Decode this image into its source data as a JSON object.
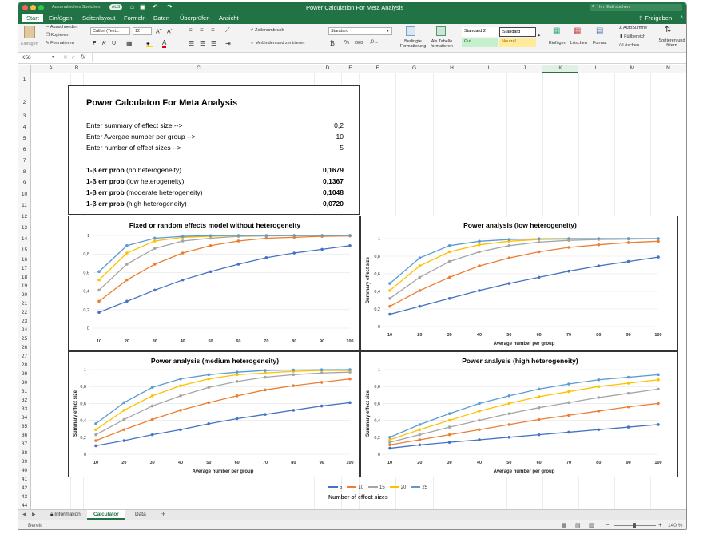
{
  "app": {
    "title": "Power Calculation For Meta Analysis",
    "autosave_label": "Automatisches Speichern",
    "autosave_state": "AUS",
    "search_placeholder": "Im Blatt suchen",
    "share_label": "Freigeben"
  },
  "ribbon_tabs": [
    "Start",
    "Einfügen",
    "Seitenlayout",
    "Formeln",
    "Daten",
    "Überprüfen",
    "Ansicht"
  ],
  "ribbon": {
    "paste": "Einfügen",
    "cut": "Ausschneiden",
    "copy": "Kopieren",
    "format_painter": "Formatieren",
    "font_name": "Calibri (Text...",
    "font_size": "12",
    "bold": "F",
    "italic": "K",
    "underline": "U",
    "wrap_text": "Zeilenumbruch",
    "merge_center": "Verbinden und zentrieren",
    "number_format": "Standard",
    "cond_format": "Bedingte Formatierung",
    "as_table": "Als Tabelle formatieren",
    "styles": [
      "Standard 2",
      "Standard",
      "Gut",
      "Neutral"
    ],
    "insert": "Einfügen",
    "delete": "Löschen",
    "format": "Format",
    "autosum": "AutoSumme",
    "fill": "Füllbereich",
    "clear": "Löschen",
    "sort_filter": "Sortieren und filtern"
  },
  "formula_bar": {
    "name_box": "K58",
    "fx": "fx",
    "value": ""
  },
  "columns": [
    "A",
    "B",
    "C",
    "D",
    "E",
    "F",
    "G",
    "H",
    "I",
    "J",
    "K",
    "L",
    "M",
    "N"
  ],
  "rows": [
    "1",
    "2",
    "3",
    "4",
    "5",
    "6",
    "7",
    "8",
    "9",
    "10",
    "11",
    "12",
    "13",
    "14",
    "15",
    "16",
    "17",
    "18",
    "19",
    "20",
    "21",
    "22",
    "23",
    "24",
    "25",
    "26",
    "27",
    "28",
    "29",
    "30",
    "31",
    "32",
    "33",
    "34",
    "35",
    "36",
    "37",
    "38",
    "39",
    "40",
    "41",
    "42",
    "43",
    "44",
    "45"
  ],
  "calculator": {
    "heading": "Power Calculaton For Meta Analysis",
    "inputs": [
      {
        "label": "Enter summary of effect size -->",
        "value": "0,2"
      },
      {
        "label": "Enter Avergae number per group -->",
        "value": "10"
      },
      {
        "label": "Enter number of effect sizes -->",
        "value": "5"
      }
    ],
    "outputs": [
      {
        "label_bold": "1-β err prob",
        "label_rest": " (no heterogeneity)",
        "value": "0,1679"
      },
      {
        "label_bold": "1-β err prob",
        "label_rest": " (low heterogeneity)",
        "value": "0,1367"
      },
      {
        "label_bold": "1-β err prob",
        "label_rest": " (moderate heterogeneity)",
        "value": "0,1048"
      },
      {
        "label_bold": "1-β err prob",
        "label_rest": " (high heterogeneity)",
        "value": "0,0720"
      }
    ]
  },
  "series_colors": {
    "5": "#4472c4",
    "10": "#ed7d31",
    "15": "#a5a5a5",
    "20": "#ffc000",
    "25": "#5b9bd5"
  },
  "legend": {
    "items": [
      "5",
      "10",
      "15",
      "20",
      "25"
    ],
    "title": "Number of effect sizes"
  },
  "chart_data": [
    {
      "type": "line",
      "title": "Fixed or random effects model without heterogeneity",
      "xlabel": "",
      "ylabel": "",
      "x": [
        10,
        20,
        30,
        40,
        50,
        60,
        70,
        80,
        90,
        100
      ],
      "ylim": [
        0,
        1
      ],
      "yticks": [
        "0",
        "0,2",
        "0,4",
        "0,6",
        "0,8",
        "1"
      ],
      "series": [
        {
          "name": "5",
          "values": [
            0.17,
            0.29,
            0.41,
            0.52,
            0.61,
            0.69,
            0.76,
            0.81,
            0.85,
            0.89
          ]
        },
        {
          "name": "10",
          "values": [
            0.29,
            0.52,
            0.69,
            0.81,
            0.89,
            0.94,
            0.97,
            0.98,
            0.99,
            0.995
          ]
        },
        {
          "name": "15",
          "values": [
            0.41,
            0.69,
            0.86,
            0.94,
            0.97,
            0.99,
            0.995,
            0.998,
            0.999,
            1.0
          ]
        },
        {
          "name": "20",
          "values": [
            0.52,
            0.81,
            0.94,
            0.98,
            0.99,
            0.998,
            1.0,
            1.0,
            1.0,
            1.0
          ]
        },
        {
          "name": "25",
          "values": [
            0.61,
            0.89,
            0.97,
            0.99,
            0.998,
            1.0,
            1.0,
            1.0,
            1.0,
            1.0
          ]
        }
      ]
    },
    {
      "type": "line",
      "title": "Power analysis (low heterogeneity)",
      "xlabel": "Average number per group",
      "ylabel": "Summary effect size",
      "x": [
        10,
        20,
        30,
        40,
        50,
        60,
        70,
        80,
        90,
        100
      ],
      "ylim": [
        0,
        1
      ],
      "yticks": [
        "0",
        "0,2",
        "0,4",
        "0,6",
        "0,8",
        "1"
      ],
      "series": [
        {
          "name": "5",
          "values": [
            0.14,
            0.23,
            0.32,
            0.41,
            0.49,
            0.56,
            0.63,
            0.69,
            0.74,
            0.79
          ]
        },
        {
          "name": "10",
          "values": [
            0.23,
            0.41,
            0.56,
            0.69,
            0.78,
            0.85,
            0.9,
            0.93,
            0.955,
            0.97
          ]
        },
        {
          "name": "15",
          "values": [
            0.32,
            0.56,
            0.74,
            0.85,
            0.92,
            0.96,
            0.98,
            0.99,
            0.995,
            0.998
          ]
        },
        {
          "name": "20",
          "values": [
            0.41,
            0.69,
            0.85,
            0.93,
            0.97,
            0.99,
            0.995,
            0.998,
            1.0,
            1.0
          ]
        },
        {
          "name": "25",
          "values": [
            0.49,
            0.78,
            0.92,
            0.97,
            0.99,
            0.998,
            1.0,
            1.0,
            1.0,
            1.0
          ]
        }
      ]
    },
    {
      "type": "line",
      "title": "Power analysis (medium heterogeneity)",
      "xlabel": "Average number per group",
      "ylabel": "Summary effect size",
      "x": [
        10,
        20,
        30,
        40,
        50,
        60,
        70,
        80,
        90,
        100
      ],
      "ylim": [
        0,
        1
      ],
      "yticks": [
        "0",
        "0,2",
        "0,4",
        "0,6",
        "0,8",
        "1"
      ],
      "series": [
        {
          "name": "5",
          "values": [
            0.1,
            0.16,
            0.23,
            0.29,
            0.36,
            0.42,
            0.47,
            0.52,
            0.57,
            0.61
          ]
        },
        {
          "name": "10",
          "values": [
            0.16,
            0.29,
            0.41,
            0.52,
            0.61,
            0.69,
            0.76,
            0.81,
            0.85,
            0.89
          ]
        },
        {
          "name": "15",
          "values": [
            0.23,
            0.41,
            0.57,
            0.69,
            0.79,
            0.86,
            0.91,
            0.94,
            0.96,
            0.97
          ]
        },
        {
          "name": "20",
          "values": [
            0.29,
            0.52,
            0.69,
            0.81,
            0.89,
            0.94,
            0.96,
            0.98,
            0.99,
            0.99
          ]
        },
        {
          "name": "25",
          "values": [
            0.36,
            0.61,
            0.79,
            0.89,
            0.94,
            0.97,
            0.99,
            0.995,
            0.998,
            1.0
          ]
        }
      ]
    },
    {
      "type": "line",
      "title": "Power analysis (high heterogeneity)",
      "xlabel": "Average number per group",
      "ylabel": "Summary effect size",
      "x": [
        10,
        20,
        30,
        40,
        50,
        60,
        70,
        80,
        90,
        100
      ],
      "ylim": [
        0,
        1
      ],
      "yticks": [
        "0",
        "0,2",
        "0,4",
        "0,6",
        "0,8",
        "1"
      ],
      "series": [
        {
          "name": "5",
          "values": [
            0.07,
            0.11,
            0.14,
            0.17,
            0.2,
            0.23,
            0.26,
            0.29,
            0.32,
            0.35
          ]
        },
        {
          "name": "10",
          "values": [
            0.11,
            0.17,
            0.23,
            0.29,
            0.35,
            0.41,
            0.46,
            0.51,
            0.56,
            0.6
          ]
        },
        {
          "name": "15",
          "values": [
            0.14,
            0.23,
            0.32,
            0.4,
            0.48,
            0.55,
            0.61,
            0.67,
            0.72,
            0.77
          ]
        },
        {
          "name": "20",
          "values": [
            0.17,
            0.29,
            0.4,
            0.51,
            0.6,
            0.68,
            0.74,
            0.8,
            0.84,
            0.88
          ]
        },
        {
          "name": "25",
          "values": [
            0.2,
            0.35,
            0.48,
            0.6,
            0.69,
            0.77,
            0.83,
            0.88,
            0.91,
            0.94
          ]
        }
      ]
    }
  ],
  "sheet_tabs": [
    "Information",
    "Calculator",
    "Data"
  ],
  "active_sheet": "Calculator",
  "status": {
    "ready": "Bereit",
    "zoom": "140 %"
  }
}
